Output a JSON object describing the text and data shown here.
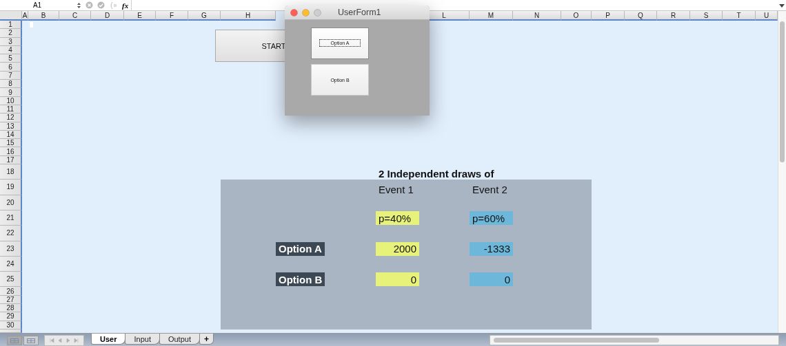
{
  "formula_bar": {
    "name_box": "A1",
    "fx": "fx"
  },
  "columns": [
    "A",
    "B",
    "C",
    "D",
    "E",
    "F",
    "G",
    "H",
    "L",
    "M",
    "N",
    "O",
    "P",
    "Q",
    "R",
    "S",
    "T",
    "U"
  ],
  "rows": [
    "1",
    "2",
    "3",
    "4",
    "5",
    "6",
    "7",
    "8",
    "9",
    "10",
    "11",
    "12",
    "13",
    "14",
    "15",
    "16",
    "17",
    "18",
    "19",
    "20",
    "21",
    "22",
    "23",
    "24",
    "25",
    "26",
    "27",
    "28",
    "29",
    "30"
  ],
  "start_button": {
    "label": "START"
  },
  "table": {
    "title": "2 Independent draws of",
    "events": [
      {
        "label": "Event 1",
        "probability": "p=40%",
        "color": "#e6f27a"
      },
      {
        "label": "Event 2",
        "probability": "p=60%",
        "color": "#6db7da"
      }
    ],
    "options": [
      {
        "label": "Option A",
        "values": [
          "2000",
          "-1333"
        ]
      },
      {
        "label": "Option B",
        "values": [
          "0",
          "0"
        ]
      }
    ]
  },
  "userform": {
    "title": "UserForm1",
    "buttons": [
      {
        "label": "Option A",
        "focused": true
      },
      {
        "label": "Option B",
        "focused": false
      }
    ]
  },
  "sheet_tabs": [
    {
      "label": "User",
      "selected": true
    },
    {
      "label": "Input",
      "selected": false
    },
    {
      "label": "Output",
      "selected": false
    }
  ],
  "add_sheet": "+"
}
